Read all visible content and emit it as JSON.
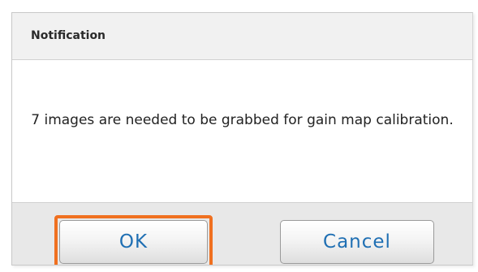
{
  "dialog": {
    "title": "Notification",
    "message": "7 images are needed to be grabbed for gain map calibration.",
    "buttons": {
      "ok_label": "OK",
      "cancel_label": "Cancel"
    },
    "focused_button": "ok"
  },
  "colors": {
    "focus_ring": "#f07020",
    "button_text": "#1f6fb3",
    "titlebar_bg": "#f1f1f1",
    "footer_bg": "#e8e8e8"
  }
}
